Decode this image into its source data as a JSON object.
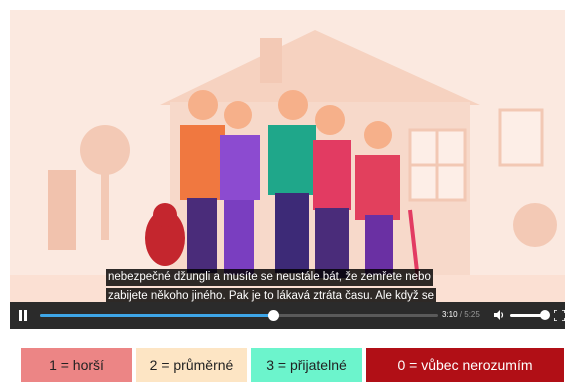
{
  "video": {
    "subtitle_line_1": "nebezpečné džungli a musíte se neustále bát, že zemřete nebo",
    "subtitle_line_2": "zabijete někoho jiného. Pak je to lákavá ztráta času. Ale když se"
  },
  "player": {
    "current_time": "3:10",
    "separator": " / ",
    "duration": "5:25",
    "progress_fraction": 0.585,
    "volume_fraction": 0.9,
    "accent_color": "#3ea6e8",
    "icons": [
      "pause-icon",
      "volume-icon",
      "fullscreen-icon"
    ]
  },
  "ratings": [
    {
      "label": "1 = horší",
      "color": "#ec8585"
    },
    {
      "label": "2 = průměrné",
      "color": "#fde5c4"
    },
    {
      "label": "3 = přijatelné",
      "color": "#6cf4cc"
    },
    {
      "label": "0 = vůbec nerozumím",
      "color": "#b10f16"
    }
  ]
}
